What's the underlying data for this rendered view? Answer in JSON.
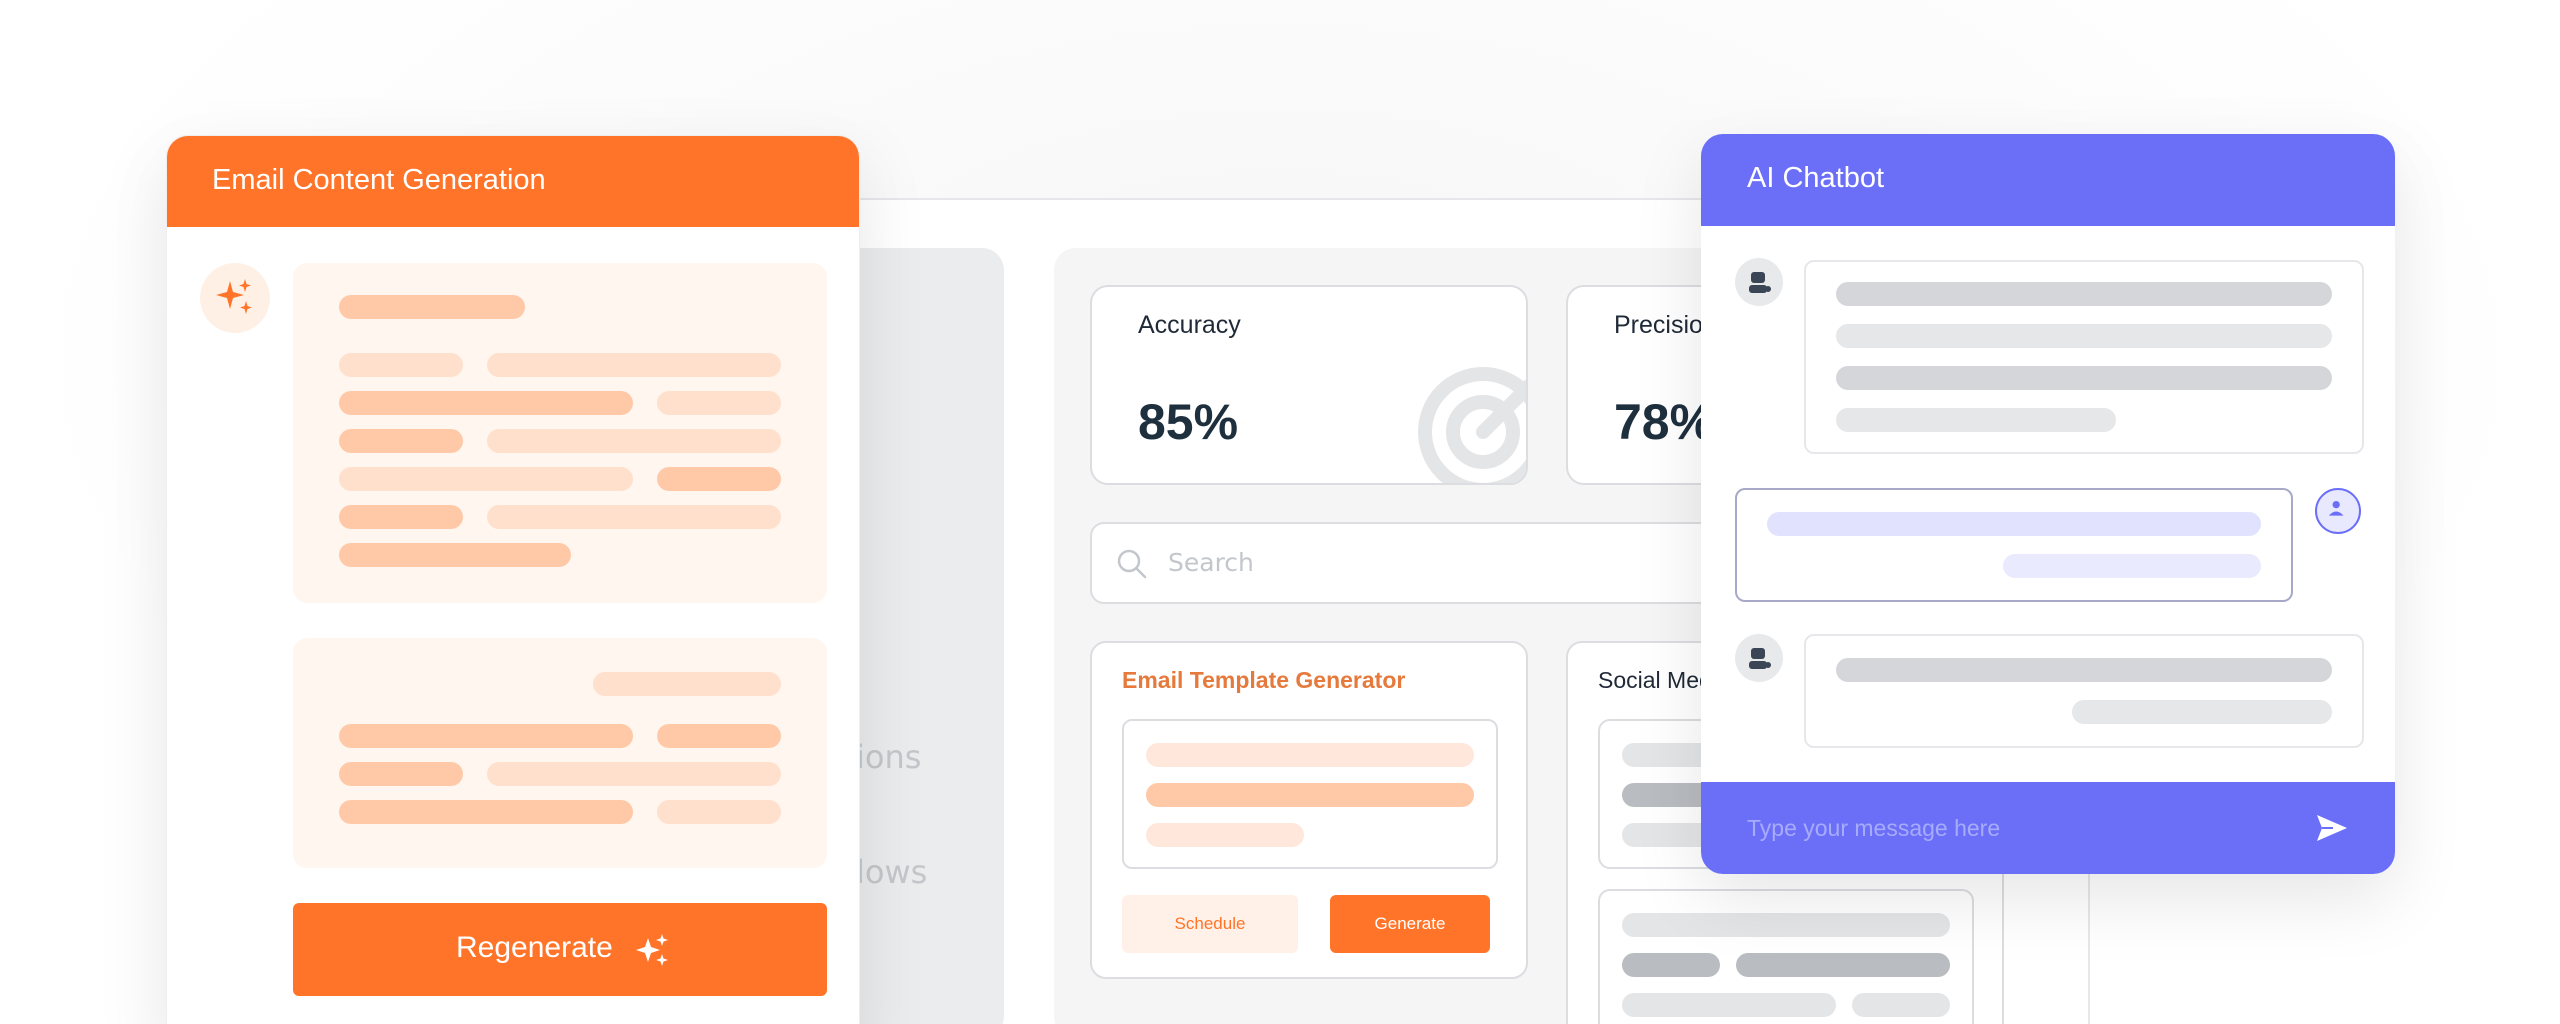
{
  "background_app": {
    "sidebar": {
      "items": [
        "ions",
        "lows"
      ]
    },
    "metrics": [
      {
        "label": "Accuracy",
        "value": "85%"
      },
      {
        "label": "Precisio",
        "value": "78%"
      }
    ],
    "search": {
      "placeholder": "Search"
    },
    "tools": [
      {
        "title": "Email Template Generator",
        "schedule_label": "Schedule",
        "generate_label": "Generate"
      },
      {
        "title": "Social Med"
      }
    ]
  },
  "email_panel": {
    "title": "Email Content Generation",
    "regenerate_label": "Regenerate"
  },
  "chat_panel": {
    "title": "AI Chatbot",
    "input_placeholder": "Type your message here"
  },
  "colors": {
    "orange_accent": "#ff7428",
    "purple_accent": "#6b6ff8",
    "skeleton_orange_light": "#ffe8db",
    "skeleton_orange": "#ffc9a8",
    "skeleton_gray": "#d4d6d9"
  },
  "icons": [
    "sparkle-icon",
    "search-icon",
    "bot-icon",
    "user-icon",
    "send-icon",
    "accuracy-target-icon"
  ]
}
